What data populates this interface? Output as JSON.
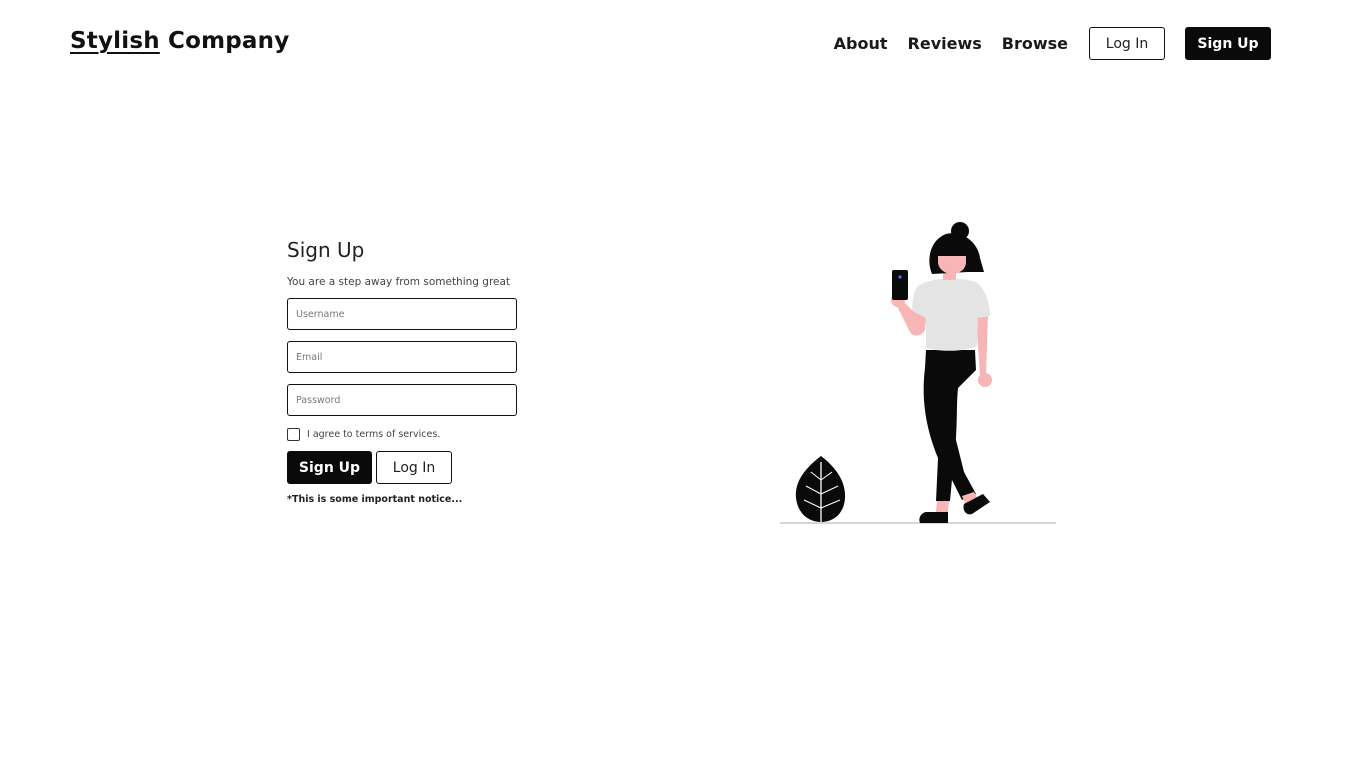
{
  "header": {
    "brand": {
      "first": "Stylish",
      "second": "Company"
    },
    "nav": {
      "links": [
        "About",
        "Reviews",
        "Browse"
      ],
      "login_label": "Log In",
      "signup_label": "Sign Up"
    }
  },
  "form": {
    "title": "Sign Up",
    "subtitle": "You are a step away from something great",
    "fields": {
      "username_placeholder": "Username",
      "email_placeholder": "Email",
      "password_placeholder": "Password"
    },
    "agree_label": "I agree to terms of services.",
    "agree_checked": false,
    "signup_label": "Sign Up",
    "login_label": "Log In",
    "notice": "*This is some important notice..."
  },
  "illustration": {
    "icon": "woman-with-phone-illustration",
    "colors": {
      "ink": "#0a0a0a",
      "shirt": "#e4e4e4",
      "skin": "#f8b5b5",
      "ground": "#c8c8c8",
      "phone_light": "#4f6bff"
    }
  }
}
